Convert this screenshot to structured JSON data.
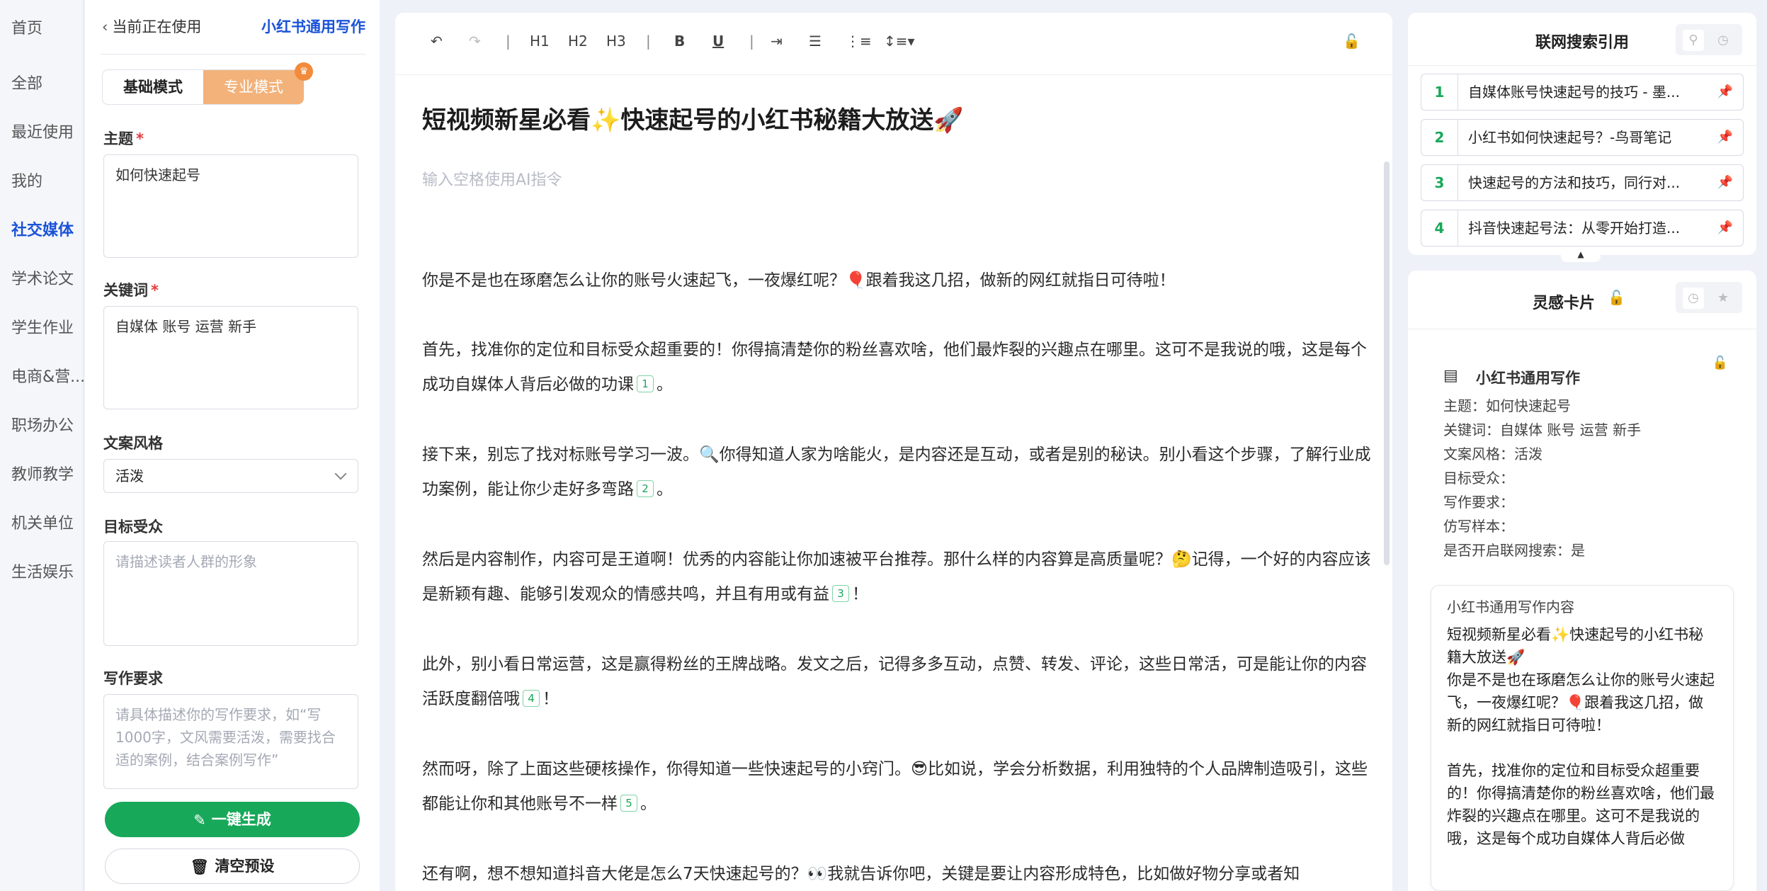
{
  "nav": {
    "items": [
      "首页",
      "全部",
      "最近使用",
      "我的",
      "社交媒体",
      "学术论文",
      "学生作业",
      "电商&营...",
      "职场办公",
      "教师教学",
      "机关单位",
      "生活娱乐"
    ],
    "active_index": 4
  },
  "settings": {
    "back_label": "当前正在使用",
    "brand_link": "小红书通用写作",
    "mode_basic": "基础模式",
    "mode_pro": "专业模式",
    "topic_label": "主题",
    "topic_value": "如何快速起号",
    "keyword_label": "关键词",
    "keyword_value": "自媒体 账号 运营 新手",
    "style_label": "文案风格",
    "style_value": "活泼",
    "audience_label": "目标受众",
    "audience_placeholder": "请描述读者人群的形象",
    "requirement_label": "写作要求",
    "requirement_placeholder": "请具体描述你的写作要求，如“写1000字，文风需要活泼，需要找合适的案例，结合案例写作”",
    "required_mark": "*",
    "generate_btn": "一键生成",
    "clear_btn": "清空预设"
  },
  "toolbar": {
    "undo": "↶",
    "redo": "↷",
    "sep": "|",
    "h1": "H1",
    "h2": "H2",
    "h3": "H3",
    "bold": "B",
    "underline": "U",
    "indent": "⇥",
    "bullet": "☰",
    "ordered": "⋮≡",
    "spacing": "↕≡▾",
    "lock": "🔓"
  },
  "editor": {
    "title": "短视频新星必看✨快速起号的小红书秘籍大放送🚀",
    "ai_hint": "输入空格使用AI指令",
    "paragraphs": [
      {
        "text": "你是不是也在琢磨怎么让你的账号火速起飞，一夜爆红呢？🎈跟着我这几招，做新的网红就指日可待啦！",
        "cite": "",
        "tail": ""
      },
      {
        "text": "首先，找准你的定位和目标受众超重要的！你得搞清楚你的粉丝喜欢啥，他们最炸裂的兴趣点在哪里。这可不是我说的哦，这是每个成功自媒体人背后必做的功课",
        "cite": "1",
        "tail": "。"
      },
      {
        "text": "接下来，别忘了找对标账号学习一波。🔍你得知道人家为啥能火，是内容还是互动，或者是别的秘诀。别小看这个步骤，了解行业成功案例，能让你少走好多弯路",
        "cite": "2",
        "tail": "。"
      },
      {
        "text": "然后是内容制作，内容可是王道啊！优秀的内容能让你加速被平台推荐。那什么样的内容算是高质量呢？🤔记得，一个好的内容应该是新颖有趣、能够引发观众的情感共鸣，并且有用或有益",
        "cite": "3",
        "tail": "！"
      },
      {
        "text": "此外，别小看日常运营，这是赢得粉丝的王牌战略。发文之后，记得多多互动，点赞、转发、评论，这些日常活，可是能让你的内容活跃度翻倍哦",
        "cite": "4",
        "tail": "！"
      },
      {
        "text": "然而呀，除了上面这些硬核操作，你得知道一些快速起号的小窍门。😎比如说，学会分析数据，利用独特的个人品牌制造吸引，这些都能让你和其他账号不一样",
        "cite": "5",
        "tail": "。"
      },
      {
        "text": "还有啊，想不想知道抖音大佬是怎么7天快速起号的？👀我就告诉你吧，关键是要让内容形成特色，比如做好物分享或者知",
        "cite": "",
        "tail": ""
      }
    ]
  },
  "refs": {
    "title": "联网搜索引用",
    "items": [
      {
        "num": "1",
        "text": "自媒体账号快速起号的技巧 - 墨..."
      },
      {
        "num": "2",
        "text": "小红书如何快速起号？-鸟哥笔记"
      },
      {
        "num": "3",
        "text": "快速起号的方法和技巧，同行对..."
      },
      {
        "num": "4",
        "text": "抖音快速起号法：从零开始打造..."
      }
    ],
    "pin_icon": "📌",
    "collapse_icon": "▲"
  },
  "inspiration": {
    "title": "灵感卡片",
    "lock_icon": "🔓",
    "summary_title": "小红书通用写作",
    "summary_rows": [
      "主题：如何快速起号",
      "关键词：自媒体  账号  运营  新手",
      "文案风格：活泼",
      "目标受众：",
      "写作要求：",
      "仿写样本：",
      "是否开启联网搜索：是"
    ],
    "card_title": "小红书通用写作内容",
    "card_body": "短视频新星必看✨快速起号的小红书秘籍大放送🚀\n你是不是也在琢磨怎么让你的账号火速起飞，一夜爆红呢？🎈跟着我这几招，做新的网红就指日可待啦！\n\n首先，找准你的定位和目标受众超重要的！你得搞清楚你的粉丝喜欢啥，他们最炸裂的兴趣点在哪里。这可不是我说的哦，这是每个成功自媒体人背后必做"
  }
}
